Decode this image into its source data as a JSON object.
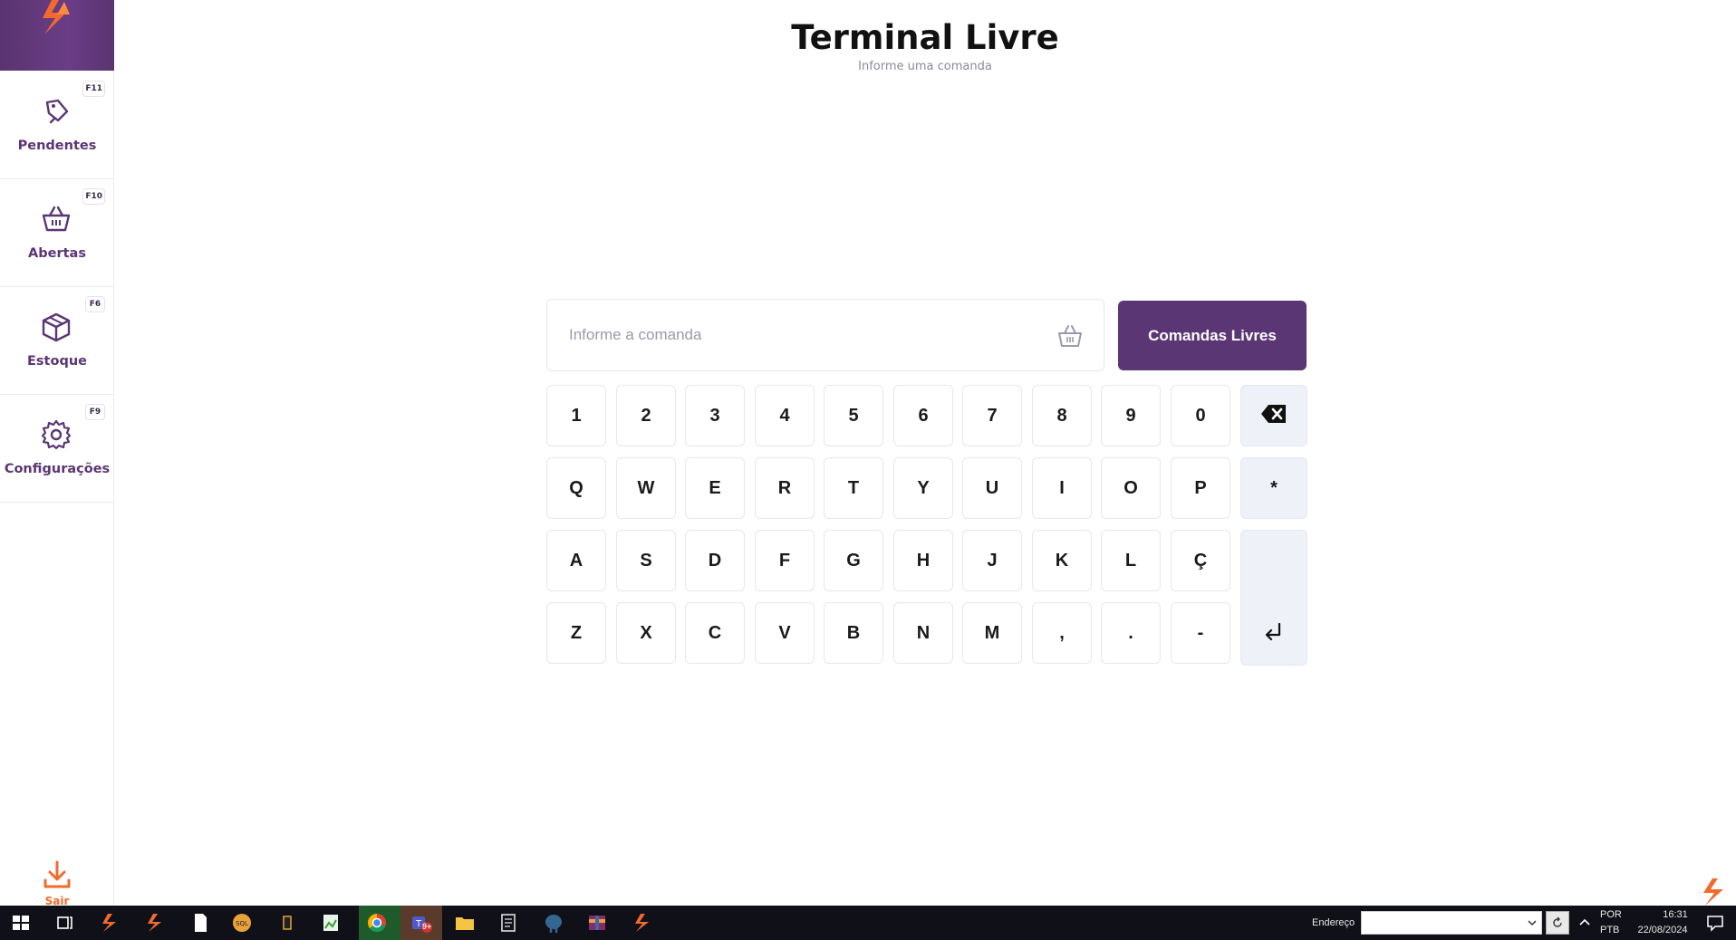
{
  "page": {
    "title": "Terminal Livre",
    "subtitle": "Informe uma comanda"
  },
  "sidebar": {
    "items": [
      {
        "label": "Pendentes",
        "shortcut": "F11",
        "icon": "tag-icon"
      },
      {
        "label": "Abertas",
        "shortcut": "F10",
        "icon": "basket-icon"
      },
      {
        "label": "Estoque",
        "shortcut": "F6",
        "icon": "box-icon"
      },
      {
        "label": "Configurações",
        "shortcut": "F9",
        "icon": "gear-icon"
      }
    ],
    "logout_label": "Sair"
  },
  "command": {
    "placeholder": "Informe a comanda",
    "value": "",
    "free_button_label": "Comandas Livres"
  },
  "keyboard": {
    "row1": [
      "1",
      "2",
      "3",
      "4",
      "5",
      "6",
      "7",
      "8",
      "9",
      "0"
    ],
    "row2": [
      "Q",
      "W",
      "E",
      "R",
      "T",
      "Y",
      "U",
      "I",
      "O",
      "P"
    ],
    "row3": [
      "A",
      "S",
      "D",
      "F",
      "G",
      "H",
      "J",
      "K",
      "L",
      "Ç"
    ],
    "row4": [
      "Z",
      "X",
      "C",
      "V",
      "B",
      "N",
      "M",
      ",",
      ".",
      "-"
    ],
    "asterisk": "*",
    "backspace_icon": "backspace-icon",
    "enter_icon": "enter-icon"
  },
  "taskbar": {
    "address_label": "Endereço",
    "lang_line1": "POR",
    "lang_line2": "PTB",
    "time": "16:31",
    "date": "22/08/2024",
    "teams_badge": "9+"
  },
  "colors": {
    "brand_purple": "#5b3675",
    "accent_orange": "#f26a2e",
    "key_special_bg": "#eef1f8"
  }
}
